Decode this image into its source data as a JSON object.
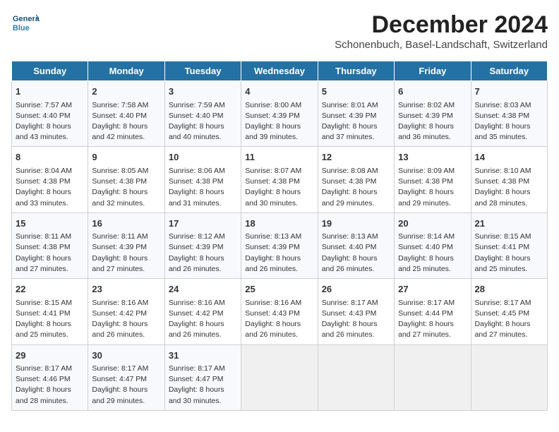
{
  "header": {
    "logo_general": "General",
    "logo_blue": "Blue",
    "month_title": "December 2024",
    "subtitle": "Schonenbuch, Basel-Landschaft, Switzerland"
  },
  "weekdays": [
    "Sunday",
    "Monday",
    "Tuesday",
    "Wednesday",
    "Thursday",
    "Friday",
    "Saturday"
  ],
  "weeks": [
    [
      {
        "day": "1",
        "info": "Sunrise: 7:57 AM\nSunset: 4:40 PM\nDaylight: 8 hours\nand 43 minutes."
      },
      {
        "day": "2",
        "info": "Sunrise: 7:58 AM\nSunset: 4:40 PM\nDaylight: 8 hours\nand 42 minutes."
      },
      {
        "day": "3",
        "info": "Sunrise: 7:59 AM\nSunset: 4:40 PM\nDaylight: 8 hours\nand 40 minutes."
      },
      {
        "day": "4",
        "info": "Sunrise: 8:00 AM\nSunset: 4:39 PM\nDaylight: 8 hours\nand 39 minutes."
      },
      {
        "day": "5",
        "info": "Sunrise: 8:01 AM\nSunset: 4:39 PM\nDaylight: 8 hours\nand 37 minutes."
      },
      {
        "day": "6",
        "info": "Sunrise: 8:02 AM\nSunset: 4:39 PM\nDaylight: 8 hours\nand 36 minutes."
      },
      {
        "day": "7",
        "info": "Sunrise: 8:03 AM\nSunset: 4:38 PM\nDaylight: 8 hours\nand 35 minutes."
      }
    ],
    [
      {
        "day": "8",
        "info": "Sunrise: 8:04 AM\nSunset: 4:38 PM\nDaylight: 8 hours\nand 33 minutes."
      },
      {
        "day": "9",
        "info": "Sunrise: 8:05 AM\nSunset: 4:38 PM\nDaylight: 8 hours\nand 32 minutes."
      },
      {
        "day": "10",
        "info": "Sunrise: 8:06 AM\nSunset: 4:38 PM\nDaylight: 8 hours\nand 31 minutes."
      },
      {
        "day": "11",
        "info": "Sunrise: 8:07 AM\nSunset: 4:38 PM\nDaylight: 8 hours\nand 30 minutes."
      },
      {
        "day": "12",
        "info": "Sunrise: 8:08 AM\nSunset: 4:38 PM\nDaylight: 8 hours\nand 29 minutes."
      },
      {
        "day": "13",
        "info": "Sunrise: 8:09 AM\nSunset: 4:38 PM\nDaylight: 8 hours\nand 29 minutes."
      },
      {
        "day": "14",
        "info": "Sunrise: 8:10 AM\nSunset: 4:38 PM\nDaylight: 8 hours\nand 28 minutes."
      }
    ],
    [
      {
        "day": "15",
        "info": "Sunrise: 8:11 AM\nSunset: 4:38 PM\nDaylight: 8 hours\nand 27 minutes."
      },
      {
        "day": "16",
        "info": "Sunrise: 8:11 AM\nSunset: 4:39 PM\nDaylight: 8 hours\nand 27 minutes."
      },
      {
        "day": "17",
        "info": "Sunrise: 8:12 AM\nSunset: 4:39 PM\nDaylight: 8 hours\nand 26 minutes."
      },
      {
        "day": "18",
        "info": "Sunrise: 8:13 AM\nSunset: 4:39 PM\nDaylight: 8 hours\nand 26 minutes."
      },
      {
        "day": "19",
        "info": "Sunrise: 8:13 AM\nSunset: 4:40 PM\nDaylight: 8 hours\nand 26 minutes."
      },
      {
        "day": "20",
        "info": "Sunrise: 8:14 AM\nSunset: 4:40 PM\nDaylight: 8 hours\nand 25 minutes."
      },
      {
        "day": "21",
        "info": "Sunrise: 8:15 AM\nSunset: 4:41 PM\nDaylight: 8 hours\nand 25 minutes."
      }
    ],
    [
      {
        "day": "22",
        "info": "Sunrise: 8:15 AM\nSunset: 4:41 PM\nDaylight: 8 hours\nand 25 minutes."
      },
      {
        "day": "23",
        "info": "Sunrise: 8:16 AM\nSunset: 4:42 PM\nDaylight: 8 hours\nand 26 minutes."
      },
      {
        "day": "24",
        "info": "Sunrise: 8:16 AM\nSunset: 4:42 PM\nDaylight: 8 hours\nand 26 minutes."
      },
      {
        "day": "25",
        "info": "Sunrise: 8:16 AM\nSunset: 4:43 PM\nDaylight: 8 hours\nand 26 minutes."
      },
      {
        "day": "26",
        "info": "Sunrise: 8:17 AM\nSunset: 4:43 PM\nDaylight: 8 hours\nand 26 minutes."
      },
      {
        "day": "27",
        "info": "Sunrise: 8:17 AM\nSunset: 4:44 PM\nDaylight: 8 hours\nand 27 minutes."
      },
      {
        "day": "28",
        "info": "Sunrise: 8:17 AM\nSunset: 4:45 PM\nDaylight: 8 hours\nand 27 minutes."
      }
    ],
    [
      {
        "day": "29",
        "info": "Sunrise: 8:17 AM\nSunset: 4:46 PM\nDaylight: 8 hours\nand 28 minutes."
      },
      {
        "day": "30",
        "info": "Sunrise: 8:17 AM\nSunset: 4:47 PM\nDaylight: 8 hours\nand 29 minutes."
      },
      {
        "day": "31",
        "info": "Sunrise: 8:17 AM\nSunset: 4:47 PM\nDaylight: 8 hours\nand 30 minutes."
      },
      {
        "day": "",
        "info": ""
      },
      {
        "day": "",
        "info": ""
      },
      {
        "day": "",
        "info": ""
      },
      {
        "day": "",
        "info": ""
      }
    ]
  ]
}
